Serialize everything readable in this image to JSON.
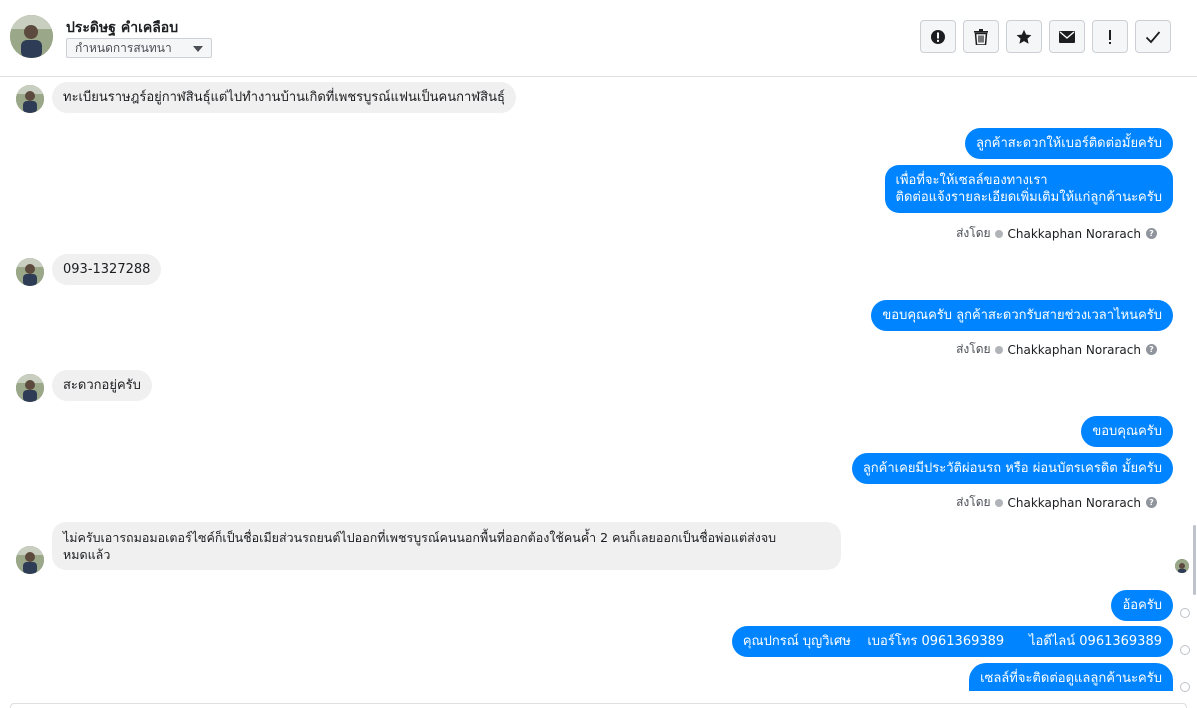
{
  "header": {
    "contact_name": "ประดิษฐ คำเคลือบ",
    "label_dropdown": "กำหนดการสนทนา",
    "toolbar": [
      {
        "icon": "alert-circle-icon",
        "label": "spam"
      },
      {
        "icon": "trash-icon",
        "label": "delete"
      },
      {
        "icon": "star-icon",
        "label": "star"
      },
      {
        "icon": "envelope-icon",
        "label": "mark-unread"
      },
      {
        "icon": "exclamation-icon",
        "label": "follow-up"
      },
      {
        "icon": "check-icon",
        "label": "done"
      }
    ]
  },
  "messages": {
    "m1": "ทะเบียนราษฎร์อยู่กาฬสินธุ์แต่ไปทำงานบ้านเกิดที่เพชรบูรณ์แฟนเป็นคนกาฬสินธุ์",
    "m2": "ลูกค้าสะดวกให้เบอร์ติดต่อมั้ยครับ",
    "m3_line1": "เพื่อที่จะให้เซลล์ของทางเรา",
    "m3_line2": "ติดต่อแจ้งรายละเอียดเพิ่มเติมให้แก่ลูกค้านะครับ",
    "m4": "093-1327288",
    "m5": "ขอบคุณครับ ลูกค้าสะดวกรับสายช่วงเวลาไหนครับ",
    "m6": "สะดวกอยู่ครับ",
    "m7": "ขอบคุณครับ",
    "m8": "ลูกค้าเคยมีประวัติผ่อนรถ หรือ ผ่อนบัตรเครดิต มั้ยครับ",
    "m9_line1": "ไม่ครับเอารถมอมอเตอร์ไซค์ก็เป็นชื่อเมียส่วนรถยนต์ไปออกที่เพชรบูรณ์คนนอกพื้นที่ออกต้องใช้คนค้ำ 2 คนก็เลยออกเป็นชื่อพ่อแต่ส่งจบ",
    "m9_line2": "หมดแล้ว",
    "m10": "อ้อครับ",
    "m11": "คุณปกรณ์ บุญวิเศษ    เบอร์โทร 0961369389      ไอดีไลน์ 0961369389",
    "m12": "เซลล์ที่จะติดต่อดูแลลูกค้านะครับ"
  },
  "sent_by": {
    "prefix": "ส่งโดย",
    "name": "Chakkaphan Norarach",
    "help": "?"
  },
  "colors": {
    "outgoing": "#0084ff",
    "incoming": "#f1f0f0"
  }
}
